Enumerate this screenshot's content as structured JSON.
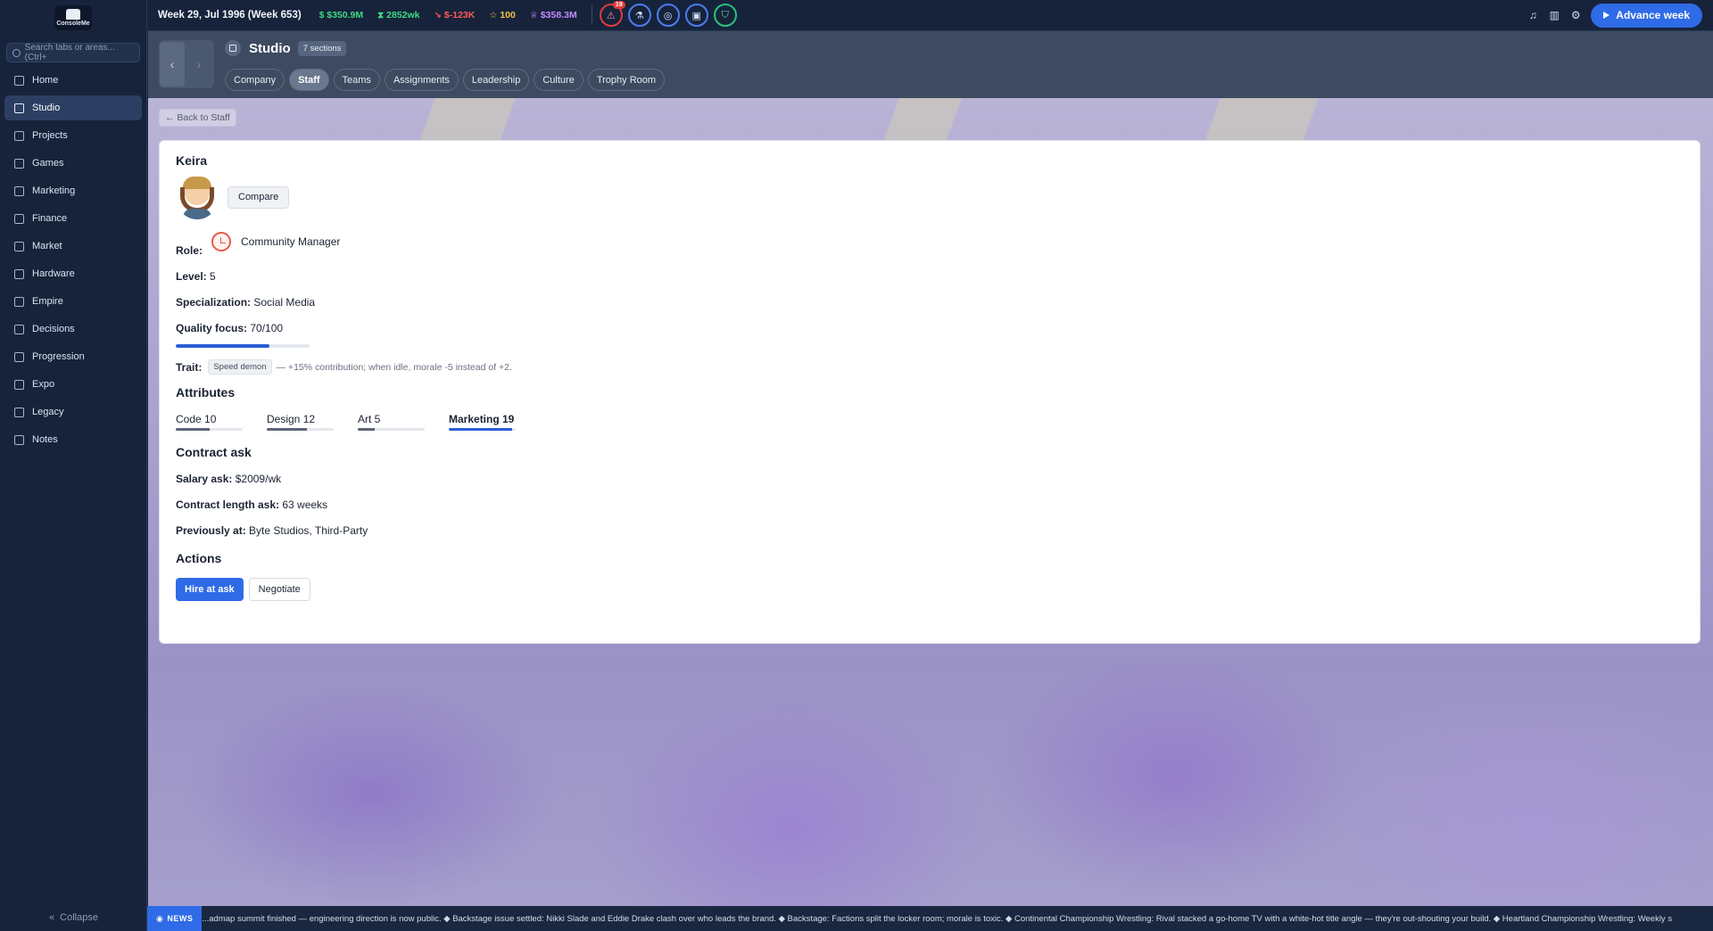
{
  "app": {
    "logo_text": "ConsoleMe"
  },
  "sidebar": {
    "search_placeholder": "Search tabs or areas... (Ctrl+",
    "items": [
      {
        "label": "Home",
        "icon": "grid-icon"
      },
      {
        "label": "Studio",
        "icon": "building-icon"
      },
      {
        "label": "Projects",
        "icon": "folder-icon"
      },
      {
        "label": "Games",
        "icon": "gamepad-icon"
      },
      {
        "label": "Marketing",
        "icon": "megaphone-icon"
      },
      {
        "label": "Finance",
        "icon": "bank-icon"
      },
      {
        "label": "Market",
        "icon": "globe-icon"
      },
      {
        "label": "Hardware",
        "icon": "chip-icon"
      },
      {
        "label": "Empire",
        "icon": "crown-icon"
      },
      {
        "label": "Decisions",
        "icon": "triangle-alert-icon"
      },
      {
        "label": "Progression",
        "icon": "flask-icon"
      },
      {
        "label": "Expo",
        "icon": "presentation-icon"
      },
      {
        "label": "Legacy",
        "icon": "book-icon"
      },
      {
        "label": "Notes",
        "icon": "notes-icon"
      }
    ],
    "active_index": 1,
    "collapse_label": "Collapse"
  },
  "topbar": {
    "week": "Week 29, Jul 1996 (Week 653)",
    "cash": "$350.9M",
    "weekly": "2852wk",
    "delta": "$-123K",
    "fans": "100",
    "valuation": "$358.3M",
    "alert_count": "19",
    "advance_label": "Advance week",
    "colors": {
      "cash": "#3ddc84",
      "weekly": "#3ddc84",
      "delta": "#ff5a5a",
      "fans": "#f5c542",
      "valuation": "#c58bff"
    }
  },
  "header": {
    "title": "Studio",
    "sections_pill": "7 sections",
    "tabs": [
      "Company",
      "Staff",
      "Teams",
      "Assignments",
      "Leadership",
      "Culture",
      "Trophy Room"
    ],
    "active_tab": 1
  },
  "main": {
    "back_label": "← Back to Staff",
    "candidate": {
      "name": "Keira",
      "compare_label": "Compare",
      "role_label": "Role:",
      "role_value": "Community Manager",
      "level_label": "Level:",
      "level_value": "5",
      "spec_label": "Specialization:",
      "spec_value": "Social Media",
      "quality_label": "Quality focus:",
      "quality_value": "70/100",
      "quality_fraction": 0.7,
      "trait_label": "Trait:",
      "trait_pill": "Speed demon",
      "trait_desc": "— +15% contribution; when idle, morale -5 instead of +2.",
      "attributes_title": "Attributes",
      "attributes": [
        {
          "label": "Code 10",
          "value": 10
        },
        {
          "label": "Design 12",
          "value": 12
        },
        {
          "label": "Art 5",
          "value": 5
        },
        {
          "label": "Marketing 19",
          "value": 19
        }
      ],
      "attribute_max": 20,
      "contract_title": "Contract ask",
      "salary_label": "Salary ask:",
      "salary_value": "$2009/wk",
      "length_label": "Contract length ask:",
      "length_value": "63 weeks",
      "prev_label": "Previously at:",
      "prev_value": "Byte Studios, Third-Party",
      "actions_title": "Actions",
      "hire_label": "Hire at ask",
      "negotiate_label": "Negotiate"
    }
  },
  "ticker": {
    "tag": "NEWS",
    "text": "...admap summit finished — engineering direction is now public. ◆ Backstage issue settled: Nikki Slade and Eddie Drake clash over who leads the brand. ◆ Backstage: Factions split the locker room; morale is toxic. ◆ Continental Championship Wrestling: Rival stacked a go-home TV with a white-hot title angle — they're out-shouting your build. ◆ Heartland Championship Wrestling: Weekly s"
  }
}
